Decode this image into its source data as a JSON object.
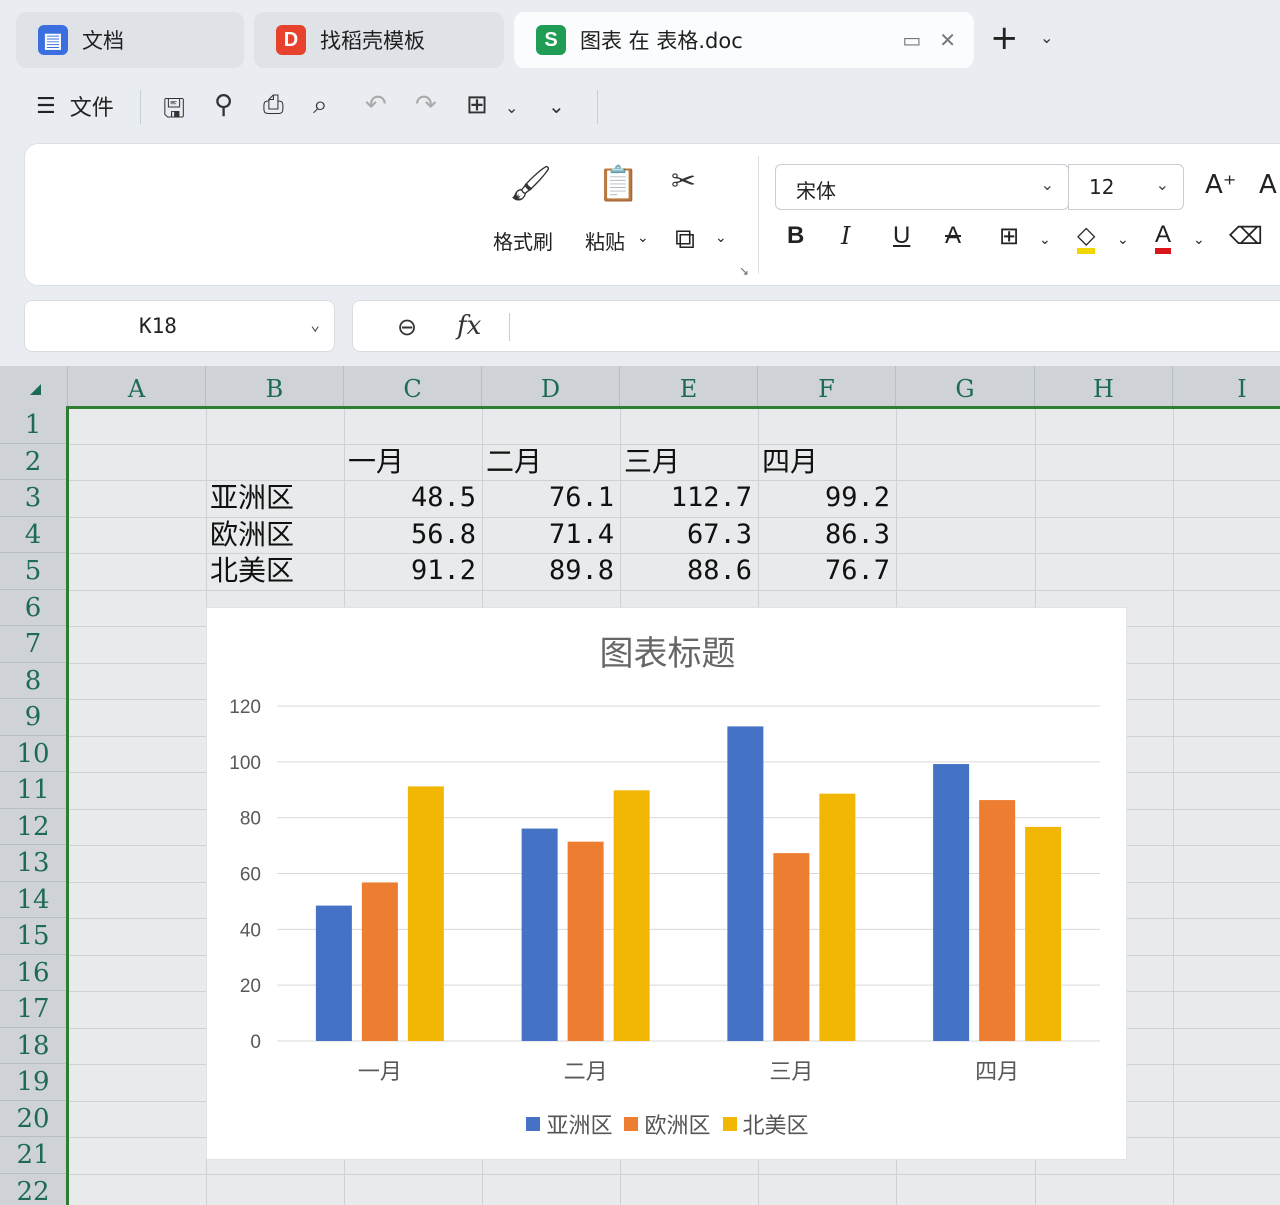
{
  "tabs": [
    {
      "label": "文档",
      "icon": "docs-icon",
      "color": "#3b6fe0",
      "glyph": "▤"
    },
    {
      "label": "找稻壳模板",
      "icon": "docer-icon",
      "color": "#e8412e",
      "glyph": "D"
    },
    {
      "label": "图表 在 表格.doc",
      "icon": "spreadsheet-icon",
      "color": "#1f9d55",
      "glyph": "S"
    }
  ],
  "toolbar": {
    "menu_label": "文件",
    "menu_icon": "☰"
  },
  "ribbon": {
    "format_painter": "格式刷",
    "paste": "粘贴",
    "font_name": "宋体",
    "font_size": "12",
    "increase_font": "A⁺",
    "bold": "B",
    "italic": "I",
    "underline": "U",
    "strikethrough": "A",
    "font_color_glyph": "A"
  },
  "formula": {
    "cell_ref": "K18",
    "fx": "fx",
    "value": ""
  },
  "grid": {
    "columns": [
      "A",
      "B",
      "C",
      "D",
      "E",
      "F",
      "G",
      "H",
      "I"
    ],
    "rows": [
      "1",
      "2",
      "3",
      "4",
      "5",
      "6",
      "7",
      "8",
      "9",
      "10",
      "11",
      "12",
      "13",
      "14",
      "15",
      "16",
      "17",
      "18",
      "19",
      "20",
      "21",
      "22"
    ],
    "header_row": [
      "一月",
      "二月",
      "三月",
      "四月"
    ],
    "data_rows": [
      {
        "label": "亚洲区",
        "values": [
          "48.5",
          "76.1",
          "112.7",
          "99.2"
        ]
      },
      {
        "label": "欧洲区",
        "values": [
          "56.8",
          "71.4",
          "67.3",
          "86.3"
        ]
      },
      {
        "label": "北美区",
        "values": [
          "91.2",
          "89.8",
          "88.6",
          "76.7"
        ]
      }
    ]
  },
  "chart_data": {
    "type": "bar",
    "title": "图表标题",
    "categories": [
      "一月",
      "二月",
      "三月",
      "四月"
    ],
    "series": [
      {
        "name": "亚洲区",
        "color": "#4472c4",
        "values": [
          48.5,
          76.1,
          112.7,
          99.2
        ]
      },
      {
        "name": "欧洲区",
        "color": "#ed7d31",
        "values": [
          56.8,
          71.4,
          67.3,
          86.3
        ]
      },
      {
        "name": "北美区",
        "color": "#f2b705",
        "values": [
          91.2,
          89.8,
          88.6,
          76.7
        ]
      }
    ],
    "ylim": [
      0,
      120
    ],
    "yticks": [
      0,
      20,
      40,
      60,
      80,
      100,
      120
    ],
    "grid": true,
    "legend": "bottom",
    "xlabel": "",
    "ylabel": ""
  }
}
